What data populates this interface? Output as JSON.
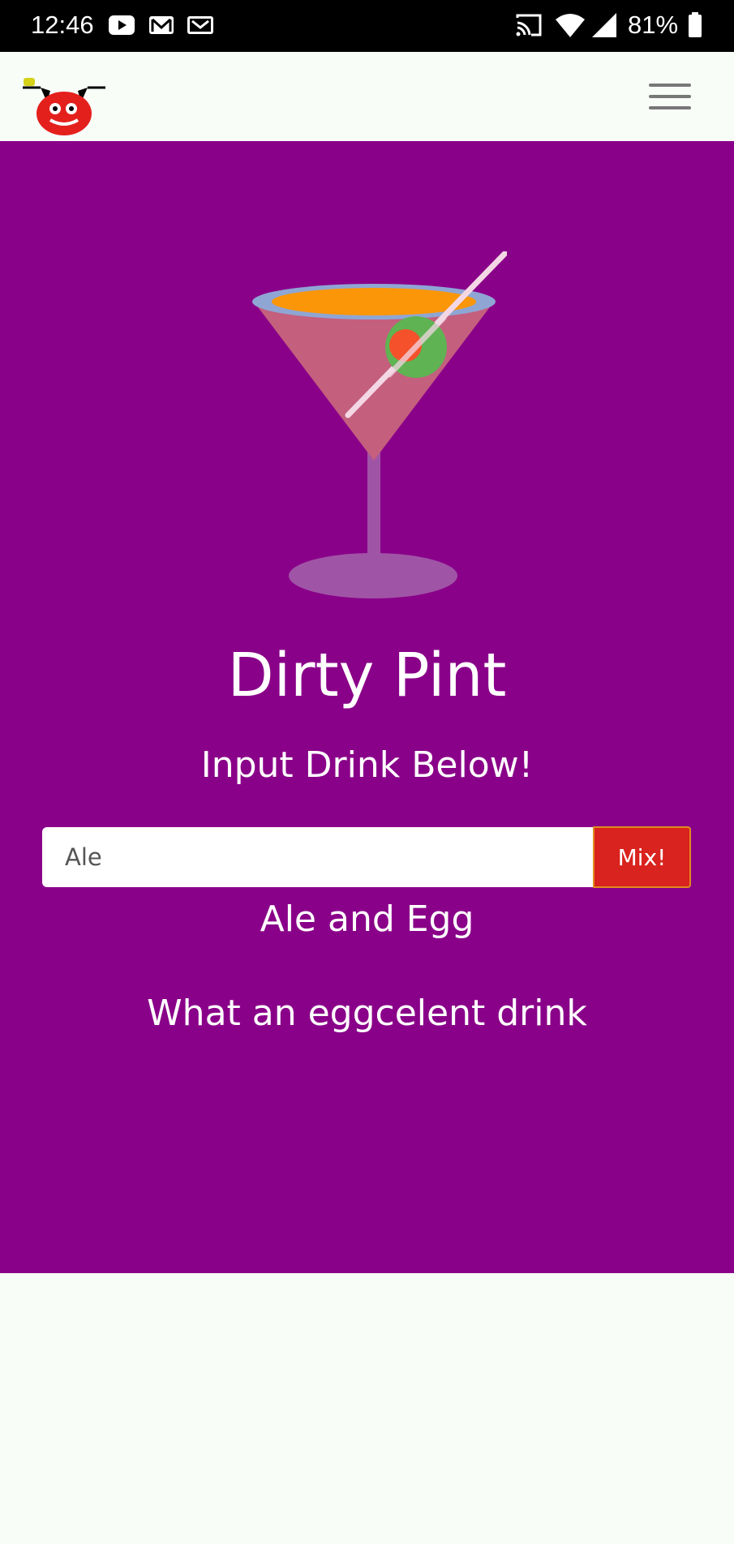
{
  "status_bar": {
    "time": "12:46",
    "battery": "81%",
    "left_icons": [
      "youtube-icon",
      "gmail-icon",
      "gmail-icon"
    ],
    "right_icons": [
      "cast-icon",
      "wifi-icon",
      "signal-icon",
      "battery-icon"
    ]
  },
  "header": {
    "logo": "devil-face-logo-icon",
    "menu_icon": "hamburger-menu-icon"
  },
  "hero": {
    "background_color": "#8a0189",
    "image": "cocktail-glass-icon",
    "title": "Dirty Pint",
    "subtitle": "Input Drink Below!",
    "input_value": "Ale",
    "mix_label": "Mix!",
    "mix_color": "#d9231e",
    "result_name": "Ale and Egg",
    "result_description": "What an eggcelent drink"
  }
}
